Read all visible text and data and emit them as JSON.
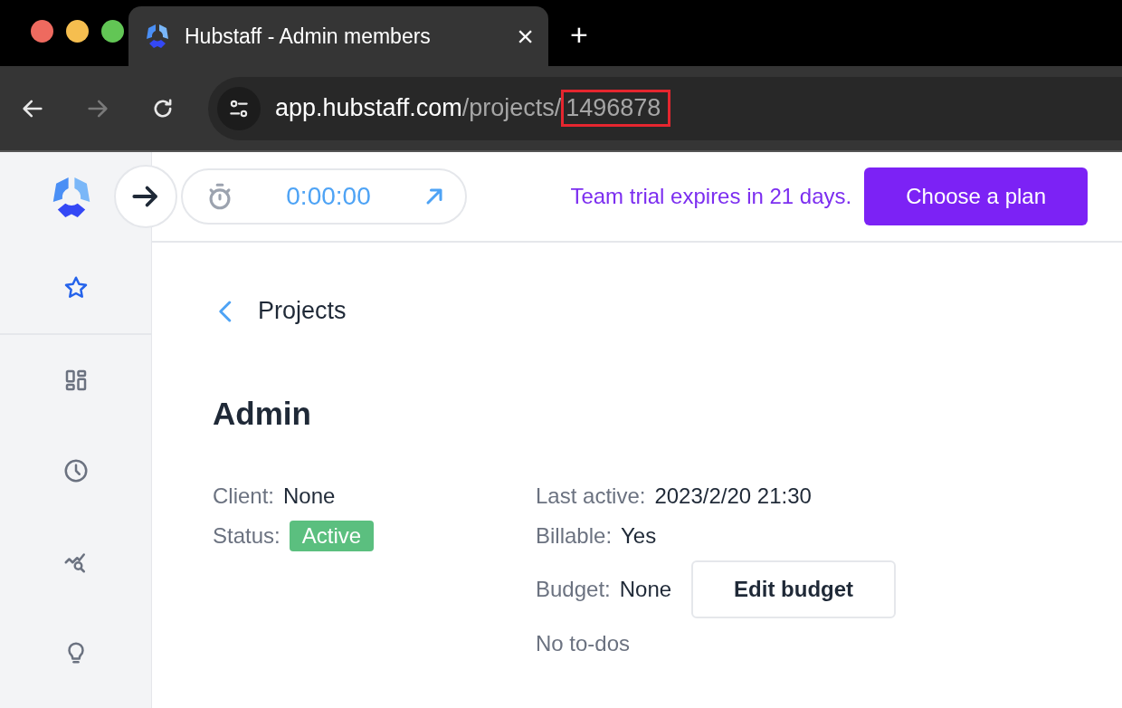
{
  "browser": {
    "tab_title": "Hubstaff - Admin members",
    "close": "×",
    "new_tab": "+",
    "url": {
      "domain": "app.hubstaff.com",
      "path": "/projects/",
      "id": "1496878",
      "id_highlighted": true
    }
  },
  "sidebar": {
    "items": [
      {
        "kind": "star",
        "selected": true
      },
      {
        "kind": "dashboard",
        "selected": false
      },
      {
        "kind": "clock",
        "selected": false
      },
      {
        "kind": "insights",
        "selected": false
      },
      {
        "kind": "bulb",
        "selected": false
      }
    ]
  },
  "timer": {
    "time": "0:00:00"
  },
  "trial": {
    "message": "Team trial expires in 21 days.",
    "button": "Choose a plan"
  },
  "back_link": "Projects",
  "project": {
    "title": "Admin",
    "left": [
      {
        "label": "Client:",
        "value": "None",
        "kind": "text"
      },
      {
        "label": "Status:",
        "value": "Active",
        "kind": "badge"
      }
    ],
    "right": [
      {
        "label": "Last active:",
        "value": "2023/2/20 21:30"
      },
      {
        "label": "Billable:",
        "value": "Yes"
      },
      {
        "label": "Budget:",
        "value": "None",
        "button": "Edit budget"
      }
    ],
    "todos": "No to-dos"
  }
}
